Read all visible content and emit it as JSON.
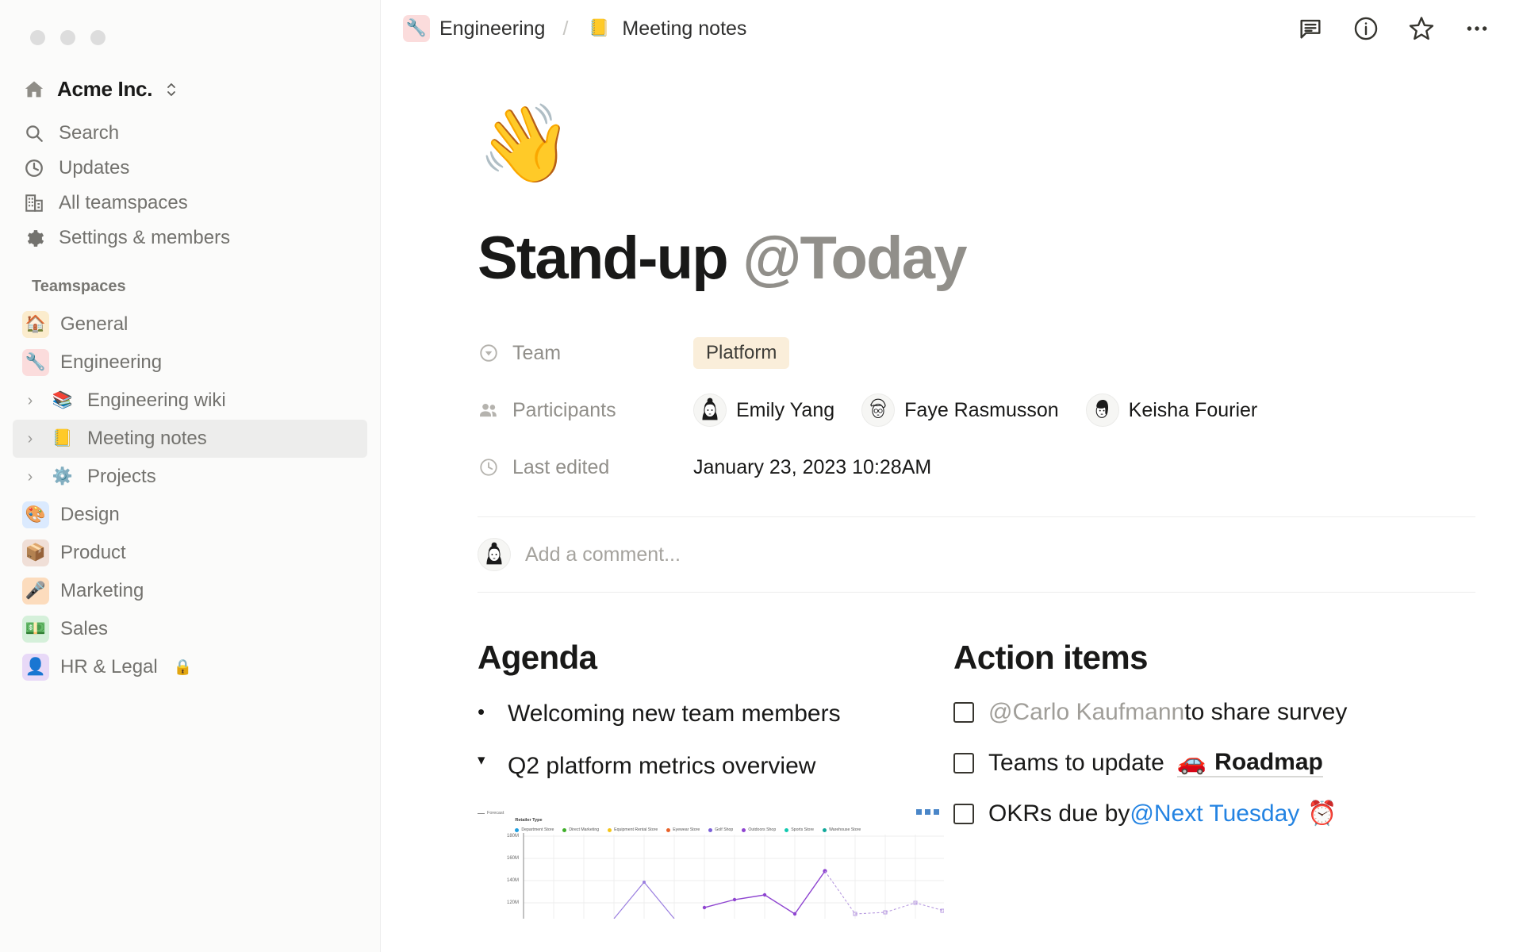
{
  "window": {
    "traffic_lights": [
      "close",
      "minimize",
      "maximize"
    ]
  },
  "sidebar": {
    "workspace": {
      "name": "Acme Inc.",
      "icon": "house-icon"
    },
    "nav": [
      {
        "label": "Search",
        "icon": "search-icon"
      },
      {
        "label": "Updates",
        "icon": "clock-icon"
      },
      {
        "label": "All teamspaces",
        "icon": "building-icon"
      },
      {
        "label": "Settings & members",
        "icon": "gear-icon"
      }
    ],
    "section_label": "Teamspaces",
    "teamspaces": [
      {
        "label": "General",
        "emoji": "🏠",
        "bg": "#fbeccd",
        "arrow": false,
        "indent": 0,
        "selected": false
      },
      {
        "label": "Engineering",
        "emoji": "🔧",
        "bg": "#fbdcdc",
        "arrow": false,
        "indent": 0,
        "selected": false
      },
      {
        "label": "Engineering wiki",
        "emoji": "📚",
        "bg": "transparent",
        "arrow": true,
        "indent": 1,
        "selected": false
      },
      {
        "label": "Meeting notes",
        "emoji": "📒",
        "bg": "transparent",
        "arrow": true,
        "indent": 1,
        "selected": true
      },
      {
        "label": "Projects",
        "emoji": "⚙️",
        "bg": "transparent",
        "arrow": true,
        "indent": 1,
        "selected": false
      },
      {
        "label": "Design",
        "emoji": "🎨",
        "bg": "#dbeafe",
        "arrow": false,
        "indent": 0,
        "selected": false
      },
      {
        "label": "Product",
        "emoji": "📦",
        "bg": "#f0dfd7",
        "arrow": false,
        "indent": 0,
        "selected": false
      },
      {
        "label": "Marketing",
        "emoji": "🎤",
        "bg": "#fcdcbd",
        "arrow": false,
        "indent": 0,
        "selected": false
      },
      {
        "label": "Sales",
        "emoji": "💵",
        "bg": "#d5f0da",
        "arrow": false,
        "indent": 0,
        "selected": false
      },
      {
        "label": "HR & Legal",
        "emoji": "👤",
        "bg": "#e8d9f7",
        "arrow": false,
        "indent": 0,
        "selected": false,
        "locked": true,
        "lock_glyph": "🔒"
      }
    ]
  },
  "topbar": {
    "breadcrumb": [
      {
        "label": "Engineering",
        "emoji": "🔧",
        "bg": "#fbdcdc"
      },
      {
        "label": "Meeting notes",
        "emoji": "📒",
        "bg": "transparent"
      }
    ],
    "separator": "/",
    "actions": [
      {
        "name": "comment-icon",
        "label": "Comments"
      },
      {
        "name": "info-icon",
        "label": "Page info"
      },
      {
        "name": "star-icon",
        "label": "Favorite"
      },
      {
        "name": "more-icon",
        "label": "More options"
      }
    ]
  },
  "page": {
    "emoji": "👋",
    "title_main": "Stand-up ",
    "title_mention": "@Today",
    "properties": [
      {
        "key": "Team",
        "icon": "select-icon",
        "type": "tag",
        "value": "Platform",
        "tag_bg": "#faeeda"
      },
      {
        "key": "Participants",
        "icon": "people-icon",
        "type": "people",
        "value": [
          "Emily Yang",
          "Faye Rasmusson",
          "Keisha Fourier"
        ]
      },
      {
        "key": "Last edited",
        "icon": "clock-icon",
        "type": "text",
        "value": "January 23, 2023 10:28AM"
      }
    ],
    "comment_placeholder": "Add a comment...",
    "columns": {
      "agenda": {
        "heading": "Agenda",
        "items": [
          {
            "marker": "•",
            "text": "Welcoming new team members",
            "type": "bullet"
          },
          {
            "marker": "▾",
            "text": "Q2 platform metrics overview",
            "type": "toggle"
          }
        ]
      },
      "action_items": {
        "heading": "Action items",
        "items": [
          {
            "checked": false,
            "mention": "@Carlo Kaufmann",
            "mention_style": "muted",
            "text": " to share survey"
          },
          {
            "checked": false,
            "text": "Teams to update ",
            "link": {
              "label": "Roadmap",
              "emoji": "🚗"
            }
          },
          {
            "checked": false,
            "text": "OKRs due by ",
            "mention": "@Next Tuesday",
            "mention_style": "blue",
            "trailing_emoji": "⏰"
          }
        ]
      }
    }
  },
  "chart_data": {
    "type": "line",
    "title": "",
    "legend_title": "Retailer Type",
    "legend_position": "top",
    "forecast_label": "Forecast",
    "xlabel": "",
    "ylabel": "",
    "ytick_labels": [
      "180M",
      "160M",
      "140M",
      "120M"
    ],
    "ylim": [
      110,
      190
    ],
    "grid": true,
    "series": [
      {
        "name": "Department Store",
        "color": "#1f9fe0"
      },
      {
        "name": "Direct Marketing",
        "color": "#3fae29"
      },
      {
        "name": "Equipment Rental Store",
        "color": "#f5c518"
      },
      {
        "name": "Eyewear Store",
        "color": "#e8622a"
      },
      {
        "name": "Golf Shop",
        "color": "#7b61d8"
      },
      {
        "name": "Outdoors Shop",
        "color": "#8e44d0"
      },
      {
        "name": "Sports Store",
        "color": "#12c9b0"
      },
      {
        "name": "Warehouse Store",
        "color": "#11a89a"
      }
    ],
    "visible_points": [
      {
        "series": "Golf Shop",
        "x": 3,
        "y": 140
      },
      {
        "series": "Outdoors Shop",
        "x": 5,
        "y": 117
      },
      {
        "series": "Outdoors Shop",
        "x": 6,
        "y": 124
      },
      {
        "series": "Outdoors Shop",
        "x": 7,
        "y": 127
      },
      {
        "series": "Outdoors Shop",
        "x": 8,
        "y": 113
      },
      {
        "series": "Outdoors Shop",
        "x": 9,
        "y": 149
      },
      {
        "series": "Outdoors Shop",
        "x": 12,
        "y": 113
      },
      {
        "series": "Outdoors Shop",
        "x": 13,
        "y": 113
      },
      {
        "series": "Outdoors Shop",
        "x": 14,
        "y": 121
      }
    ],
    "toolbar_icons": [
      "filter-icon",
      "settings-icon",
      "export-icon"
    ]
  }
}
